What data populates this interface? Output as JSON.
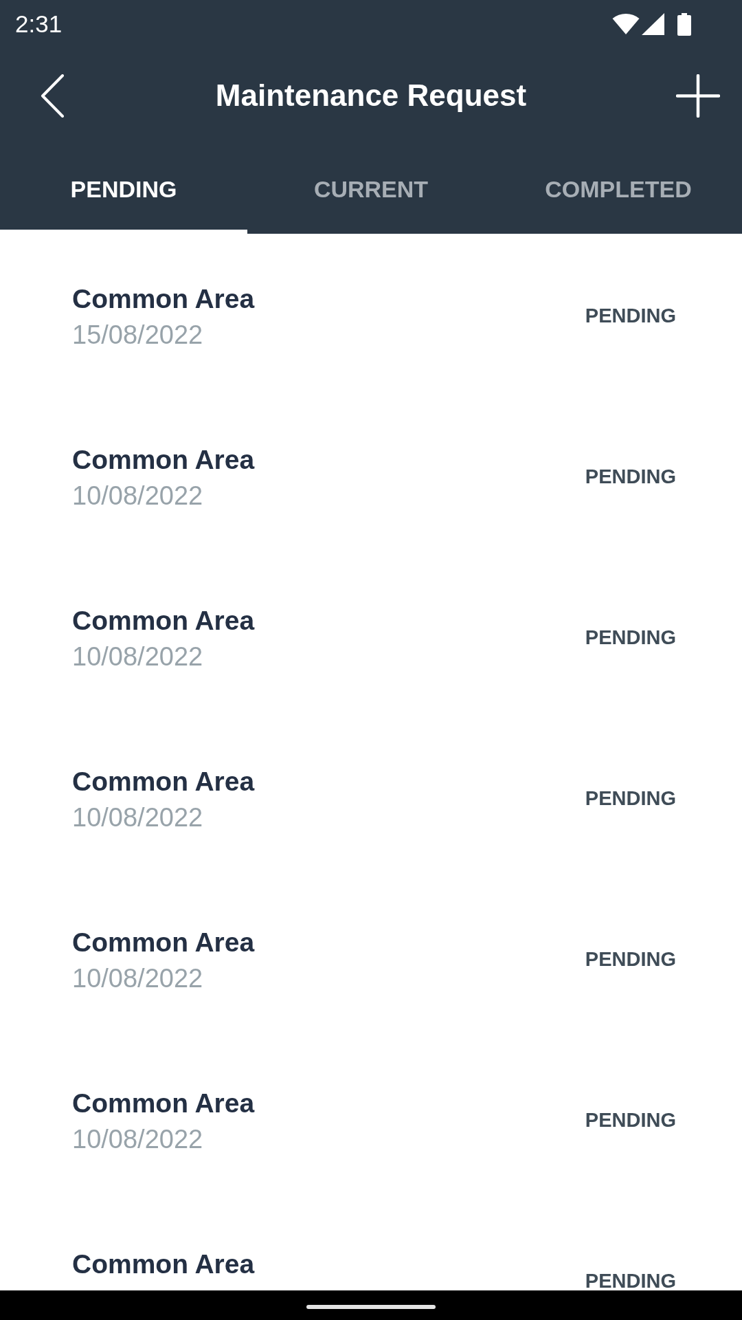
{
  "status_bar": {
    "time": "2:31"
  },
  "toolbar": {
    "title": "Maintenance Request"
  },
  "tabs": [
    {
      "label": "PENDING",
      "selected": true
    },
    {
      "label": "CURRENT",
      "selected": false
    },
    {
      "label": "COMPLETED",
      "selected": false
    }
  ],
  "requests": [
    {
      "title": "Common Area",
      "date": "15/08/2022",
      "status": "PENDING"
    },
    {
      "title": "Common Area",
      "date": "10/08/2022",
      "status": "PENDING"
    },
    {
      "title": "Common Area",
      "date": "10/08/2022",
      "status": "PENDING"
    },
    {
      "title": "Common Area",
      "date": "10/08/2022",
      "status": "PENDING"
    },
    {
      "title": "Common Area",
      "date": "10/08/2022",
      "status": "PENDING"
    },
    {
      "title": "Common Area",
      "date": "10/08/2022",
      "status": "PENDING"
    },
    {
      "title": "Common Area",
      "status": "PENDING"
    }
  ]
}
